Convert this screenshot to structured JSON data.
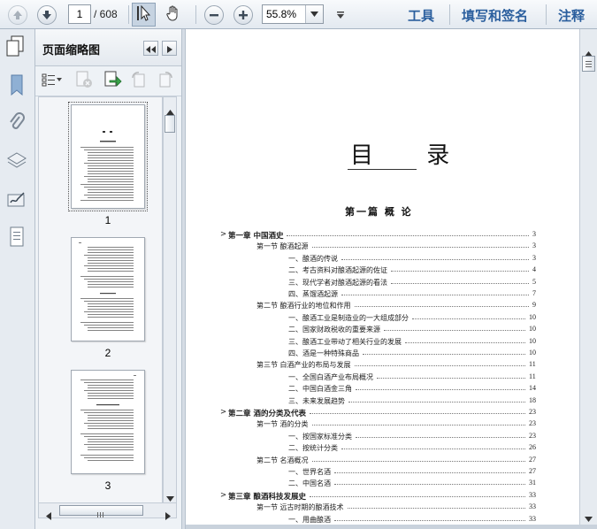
{
  "toolbar": {
    "page_current": "1",
    "page_total": "/ 608",
    "zoom": "55.8%",
    "tools_label": "工具",
    "sign_label": "填写和签名",
    "comment_label": "注释"
  },
  "panel": {
    "title": "页面缩略图",
    "thumbnails": [
      {
        "label": "1"
      },
      {
        "label": "2"
      },
      {
        "label": "3"
      }
    ]
  },
  "document": {
    "title": "目 录",
    "part_title": "第一篇 概 论",
    "toc": [
      {
        "level": 0,
        "text": "第一章  中国酒史",
        "page": "3"
      },
      {
        "level": 1,
        "text": "第一节  酿酒起源",
        "page": "3"
      },
      {
        "level": 2,
        "text": "一、酿酒的传说",
        "page": "3"
      },
      {
        "level": 2,
        "text": "二、考古资料对酿酒起源的佐证",
        "page": "4"
      },
      {
        "level": 2,
        "text": "三、现代学者对酿酒起源的看法",
        "page": "5"
      },
      {
        "level": 2,
        "text": "四、蒸馏酒起源",
        "page": "7"
      },
      {
        "level": 1,
        "text": "第二节  酿酒行业的地位和作用",
        "page": "9"
      },
      {
        "level": 2,
        "text": "一、酿酒工业是制造业的一大组成部分",
        "page": "10"
      },
      {
        "level": 2,
        "text": "二、国家财政税收的重要来源",
        "page": "10"
      },
      {
        "level": 2,
        "text": "三、酿酒工业带动了相关行业的发展",
        "page": "10"
      },
      {
        "level": 2,
        "text": "四、酒是一种特殊商品",
        "page": "10"
      },
      {
        "level": 1,
        "text": "第三节  白酒产业的布局与发展",
        "page": "11"
      },
      {
        "level": 2,
        "text": "一、全国白酒产业布局概况",
        "page": "11"
      },
      {
        "level": 2,
        "text": "二、中国白酒金三角",
        "page": "14"
      },
      {
        "level": 2,
        "text": "三、未来发展趋势",
        "page": "18"
      },
      {
        "level": 0,
        "text": "第二章  酒的分类及代表",
        "page": "23"
      },
      {
        "level": 1,
        "text": "第一节  酒的分类",
        "page": "23"
      },
      {
        "level": 2,
        "text": "一、按国家标准分类",
        "page": "23"
      },
      {
        "level": 2,
        "text": "二、按统计分类",
        "page": "26"
      },
      {
        "level": 1,
        "text": "第二节  名酒概况",
        "page": "27"
      },
      {
        "level": 2,
        "text": "一、世界名酒",
        "page": "27"
      },
      {
        "level": 2,
        "text": "二、中国名酒",
        "page": "31"
      },
      {
        "level": 0,
        "text": "第三章  酿酒科技发展史",
        "page": "33"
      },
      {
        "level": 1,
        "text": "第一节  远古时期的酿酒技术",
        "page": "33"
      },
      {
        "level": 2,
        "text": "一、用曲酿酒",
        "page": "33"
      }
    ]
  }
}
